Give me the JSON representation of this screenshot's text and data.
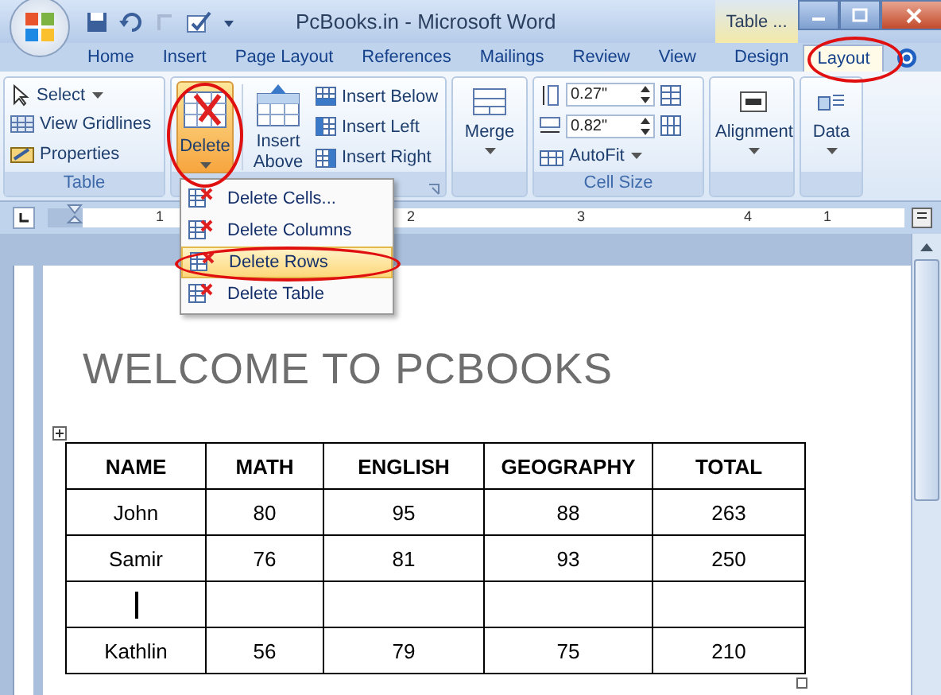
{
  "window": {
    "title": "PcBooks.in - Microsoft Word",
    "context_tab": "Table ..."
  },
  "tabs": [
    {
      "label": "Home",
      "selected": false
    },
    {
      "label": "Insert",
      "selected": false
    },
    {
      "label": "Page Layout",
      "selected": false
    },
    {
      "label": "References",
      "selected": false
    },
    {
      "label": "Mailings",
      "selected": false
    },
    {
      "label": "Review",
      "selected": false
    },
    {
      "label": "View",
      "selected": false
    },
    {
      "label": "Design",
      "selected": false
    },
    {
      "label": "Layout",
      "selected": true
    }
  ],
  "ribbon": {
    "table_group": {
      "label": "Table",
      "items": [
        "Select",
        "View Gridlines",
        "Properties"
      ]
    },
    "delete_button": {
      "label": "Delete",
      "highlighted": true
    },
    "insert_above": "Insert Above",
    "insert_items": [
      "Insert Below",
      "Insert Left",
      "Insert Right"
    ],
    "merge": "Merge",
    "cell_size": {
      "label": "Cell Size",
      "height": "0.27\"",
      "width": "0.82\"",
      "autofit": "AutoFit"
    },
    "alignment": "Alignment",
    "data": "Data"
  },
  "ruler": [
    "1",
    "2",
    "3",
    "4",
    "1"
  ],
  "delete_menu": [
    {
      "label": "Delete Cells...",
      "selected": false
    },
    {
      "label": "Delete Columns",
      "selected": false
    },
    {
      "label": "Delete Rows",
      "selected": true
    },
    {
      "label": "Delete Table",
      "selected": false
    }
  ],
  "document": {
    "heading": "WELCOME TO PCBOOKS",
    "table": {
      "columns": [
        "NAME",
        "MATH",
        "ENGLISH",
        "GEOGRAPHY",
        "TOTAL"
      ],
      "rows": [
        {
          "kind": "data",
          "cells": [
            "John",
            "80",
            "95",
            "88",
            "263"
          ]
        },
        {
          "kind": "data",
          "cells": [
            "Samir",
            "76",
            "81",
            "93",
            "250"
          ]
        },
        {
          "kind": "blank",
          "cursor": true
        },
        {
          "kind": "data",
          "cells": [
            "Kathlin",
            "56",
            "79",
            "75",
            "210"
          ]
        }
      ]
    }
  }
}
